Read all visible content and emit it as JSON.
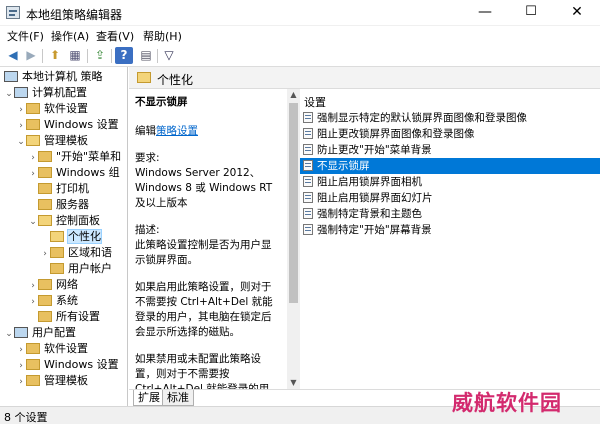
{
  "window": {
    "title": "本地组策略编辑器",
    "minimize": "—",
    "maximize": "☐",
    "close": "✕"
  },
  "menu": [
    "文件(F)",
    "操作(A)",
    "查看(V)",
    "帮助(H)"
  ],
  "toolbar": {
    "back": "◀",
    "forward": "▶",
    "up": "⬆",
    "show_tree": "▦",
    "export": "⇪",
    "help": "?",
    "properties": "▤",
    "filter": "▽"
  },
  "tree": {
    "root": "本地计算机 策略",
    "computer_config": "计算机配置",
    "software_settings": "软件设置",
    "windows_settings": "Windows 设置",
    "admin_templates": "管理模板",
    "start_menu": "\"开始\"菜单和",
    "windows_components": "Windows 组",
    "printers": "打印机",
    "servers": "服务器",
    "control_panel": "控制面板",
    "personalization": "个性化",
    "regional": "区域和语",
    "user_accounts": "用户帐户",
    "network": "网络",
    "system": "系统",
    "all_settings": "所有设置",
    "user_config": "用户配置",
    "u_software_settings": "软件设置",
    "u_windows_settings": "Windows 设置",
    "u_admin_templates": "管理模板"
  },
  "detail": {
    "header": "个性化",
    "policy_title": "不显示锁屏",
    "edit_prefix": "编辑",
    "edit_link": "策略设置",
    "requirements_label": "要求:",
    "requirements_text": "Windows Server 2012、Windows 8 或 Windows RT 及以上版本",
    "description_label": "描述:",
    "description_text": "此策略设置控制是否为用户显示锁屏界面。",
    "enabled_text": "如果启用此策略设置，则对于不需要按 Ctrl+Alt+Del 就能登录的用户，其电脑在锁定后会显示所选择的磁贴。",
    "disabled_text": "如果禁用或未配置此策略设置，则对于不需要按 Ctrl+Alt+Del 就能登录的用户，其电脑在锁定后会显示锁屏界面，用户必须滑动解锁"
  },
  "list": {
    "column_header": "设置",
    "items": [
      "强制显示特定的默认锁屏界面图像和登录图像",
      "阻止更改锁屏界面图像和登录图像",
      "防止更改\"开始\"菜单背景",
      "不显示锁屏",
      "阻止启用锁屏界面相机",
      "阻止启用锁屏界面幻灯片",
      "强制特定背景和主题色",
      "强制特定\"开始\"屏幕背景"
    ],
    "selected_index": 3
  },
  "tabs": [
    "扩展",
    "标准"
  ],
  "status": "8 个设置",
  "watermark": "威航软件园"
}
